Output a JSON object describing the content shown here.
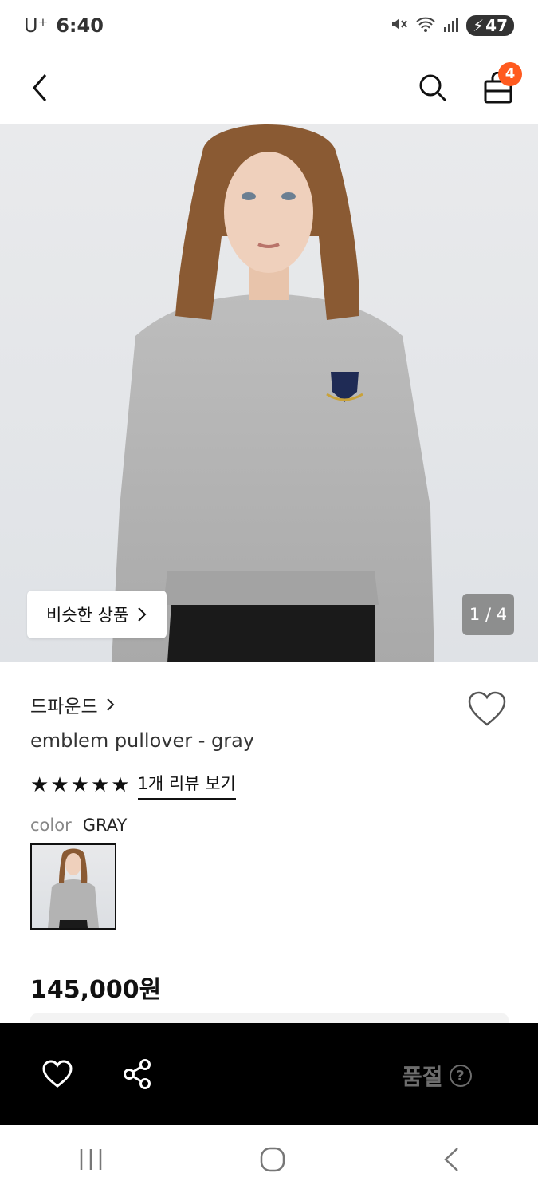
{
  "status_bar": {
    "carrier": "U⁺",
    "time": "6:40",
    "battery": "47"
  },
  "nav": {
    "cart_count": "4"
  },
  "hero": {
    "similar_label": "비슷한 상품",
    "page_indicator": "1 / 4"
  },
  "product": {
    "brand": "드파운드",
    "name": "emblem pullover - gray",
    "rating_stars": 5,
    "review_link": "1개 리뷰 보기",
    "color_label": "color",
    "color_value": "GRAY",
    "price": "145,000원"
  },
  "action_bar": {
    "sold_out_label": "품절",
    "help_glyph": "?"
  },
  "colors": {
    "cart_badge": "#ff5a1f",
    "action_bar_bg": "#000000",
    "sold_out_text": "#6d6d6d"
  }
}
